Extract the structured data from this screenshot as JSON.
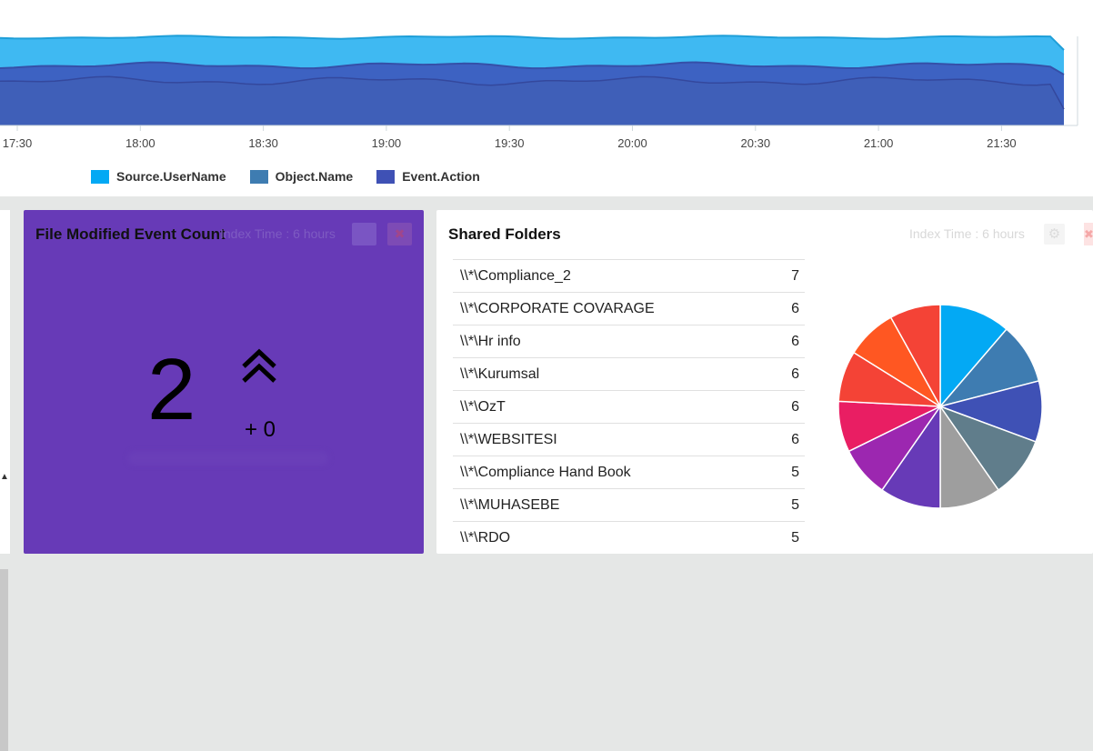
{
  "area_chart": {
    "x_ticks": [
      "17:30",
      "18:00",
      "18:30",
      "19:00",
      "19:30",
      "20:00",
      "20:30",
      "21:00",
      "21:30"
    ],
    "legend": [
      {
        "name": "Source.UserName",
        "color": "#03a9f4"
      },
      {
        "name": "Object.Name",
        "color": "#3e7cb1"
      },
      {
        "name": "Event.Action",
        "color": "#3f51b5"
      }
    ]
  },
  "kpi": {
    "title": "File Modified Event Count",
    "index_time": "Index Time : 6 hours",
    "value": "2",
    "delta": "+ 0",
    "trend_icon": "double-chevron-up-icon",
    "background": "#673ab7"
  },
  "shared_folders": {
    "title": "Shared Folders",
    "index_time": "Index Time : 6 hours",
    "rows": [
      {
        "name": "\\\\*\\Compliance_2",
        "count": "7"
      },
      {
        "name": "\\\\*\\CORPORATE COVARAGE",
        "count": "6"
      },
      {
        "name": "\\\\*\\Hr info",
        "count": "6"
      },
      {
        "name": "\\\\*\\Kurumsal",
        "count": "6"
      },
      {
        "name": "\\\\*\\OzT",
        "count": "6"
      },
      {
        "name": "\\\\*\\WEBSITESI",
        "count": "6"
      },
      {
        "name": "\\\\*\\Compliance Hand Book",
        "count": "5"
      },
      {
        "name": "\\\\*\\MUHASEBE",
        "count": "5"
      },
      {
        "name": "\\\\*\\RDO",
        "count": "5"
      }
    ]
  },
  "chart_data": [
    {
      "type": "area",
      "x": [
        "17:30",
        "18:00",
        "18:30",
        "19:00",
        "19:30",
        "20:00",
        "20:30",
        "21:00",
        "21:30"
      ],
      "stacked": true,
      "legend_position": "bottom-left",
      "series": [
        {
          "name": "Source.UserName",
          "color": "#03a9f4"
        },
        {
          "name": "Object.Name",
          "color": "#3e7cb1"
        },
        {
          "name": "Event.Action",
          "color": "#3f51b5"
        }
      ]
    },
    {
      "type": "pie",
      "categories": [
        "\\\\*\\Compliance_2",
        "\\\\*\\CORPORATE COVARAGE",
        "\\\\*\\Hr info",
        "\\\\*\\Kurumsal",
        "\\\\*\\OzT",
        "\\\\*\\WEBSITESI",
        "\\\\*\\Compliance Hand Book",
        "\\\\*\\MUHASEBE",
        "\\\\*\\RDO",
        "",
        ""
      ],
      "values": [
        7,
        6,
        6,
        6,
        6,
        6,
        5,
        5,
        5,
        5,
        5
      ],
      "colors": [
        "#03a9f4",
        "#3e7cb1",
        "#3f51b5",
        "#607d8b",
        "#9e9e9e",
        "#673ab7",
        "#9c27b0",
        "#e91e63",
        "#f44336",
        "#ff5722",
        "#f44336"
      ]
    }
  ]
}
